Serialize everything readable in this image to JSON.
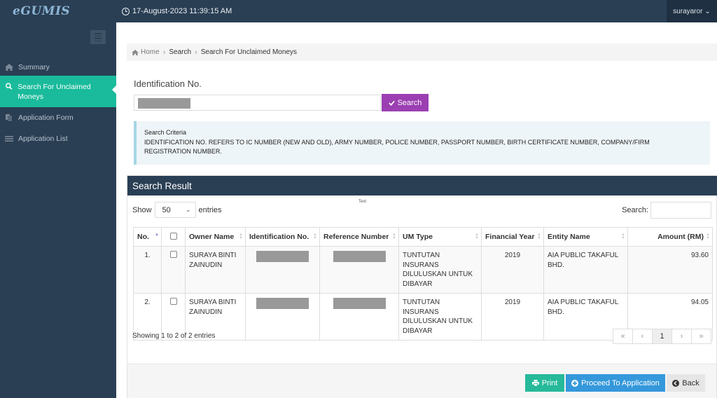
{
  "app": {
    "logo": "eGUMIS"
  },
  "topbar": {
    "datetime": "17-August-2023 11:39:15 AM",
    "username": "surayaror"
  },
  "sidebar": {
    "items": [
      {
        "label": "Summary",
        "icon": "home-icon"
      },
      {
        "label": "Search For Unclaimed Moneys",
        "icon": "search-icon",
        "active": true
      },
      {
        "label": "Application Form",
        "icon": "document-icon"
      },
      {
        "label": "Application List",
        "icon": "list-icon"
      }
    ]
  },
  "breadcrumb": {
    "home": "Home",
    "search": "Search",
    "current": "Search For Unclaimed Moneys"
  },
  "search": {
    "label": "Identification No.",
    "button": "Search",
    "criteria_title": "Search Criteria",
    "criteria_text": "IDENTIFICATION NO. REFERS TO IC NUMBER (NEW AND OLD), ARMY NUMBER, POLICE NUMBER, PASSPORT NUMBER, BIRTH CERTIFICATE NUMBER, COMPANY/FIRM REGISTRATION NUMBER."
  },
  "results": {
    "title": "Search Result",
    "show_label": "Show",
    "entries_value": "50",
    "entries_label": "entries",
    "text_note": "Text",
    "search_label": "Search:",
    "columns": [
      "No.",
      "",
      "Owner Name",
      "Identification No.",
      "Reference Number",
      "UM Type",
      "Financial Year",
      "Entity Name",
      "Amount (RM)"
    ],
    "rows": [
      {
        "no": "1.",
        "owner": "SURAYA BINTI ZAINUDIN",
        "um_type": "TUNTUTAN INSURANS DILULUSKAN UNTUK DIBAYAR",
        "year": "2019",
        "entity": "AIA PUBLIC TAKAFUL BHD.",
        "amount": "93.60"
      },
      {
        "no": "2.",
        "owner": "SURAYA BINTI ZAINUDIN",
        "um_type": "TUNTUTAN INSURANS DILULUSKAN UNTUK DIBAYAR",
        "year": "2019",
        "entity": "AIA PUBLIC TAKAFUL BHD.",
        "amount": "94.05"
      }
    ],
    "showing": "Showing 1 to 2 of 2 entries",
    "pager": {
      "first": "«",
      "prev": "‹",
      "page": "1",
      "next": "›",
      "last": "»"
    }
  },
  "actions": {
    "print": "Print",
    "proceed": "Proceed To Application",
    "back": "Back"
  }
}
